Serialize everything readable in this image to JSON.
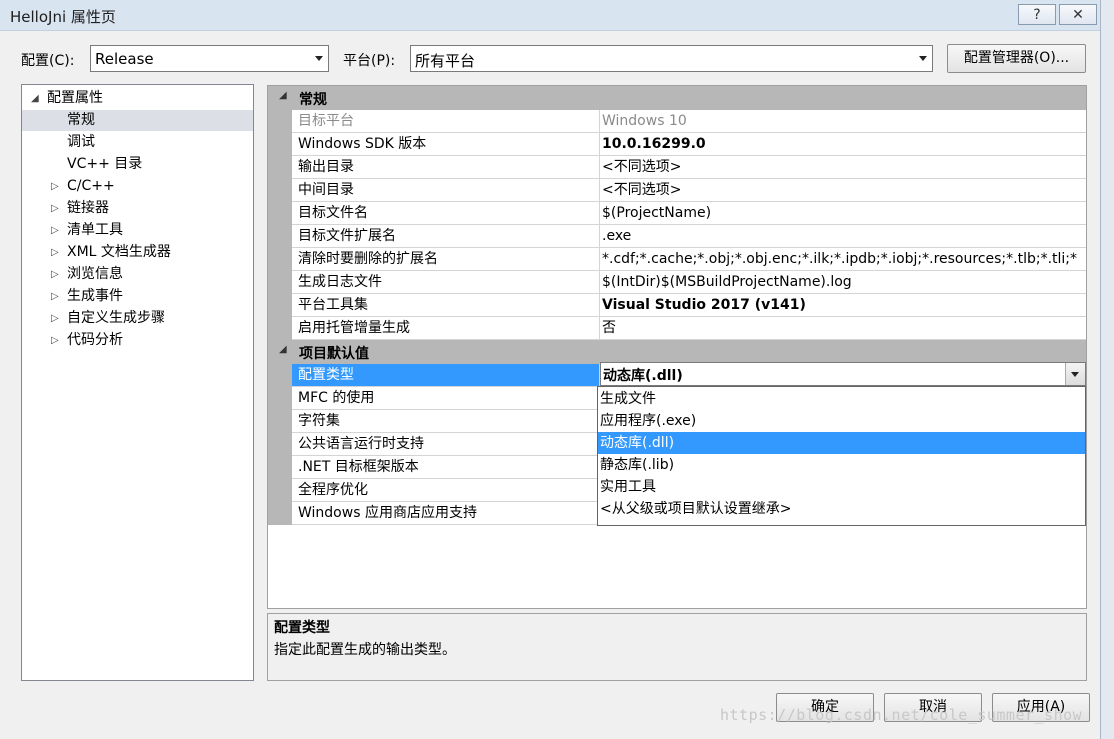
{
  "window": {
    "title": "HelloJni 属性页",
    "help_glyph": "?",
    "close_glyph": "✕"
  },
  "toolbar": {
    "config_label": "配置(C):",
    "config_value": "Release",
    "platform_label": "平台(P):",
    "platform_value": "所有平台",
    "config_manager_label": "配置管理器(O)..."
  },
  "tree": {
    "root_label": "配置属性",
    "items": [
      {
        "label": "常规",
        "selected": true,
        "expandable": false
      },
      {
        "label": "调试",
        "selected": false,
        "expandable": false
      },
      {
        "label": "VC++ 目录",
        "selected": false,
        "expandable": false
      },
      {
        "label": "C/C++",
        "selected": false,
        "expandable": true
      },
      {
        "label": "链接器",
        "selected": false,
        "expandable": true
      },
      {
        "label": "清单工具",
        "selected": false,
        "expandable": true
      },
      {
        "label": "XML 文档生成器",
        "selected": false,
        "expandable": true
      },
      {
        "label": "浏览信息",
        "selected": false,
        "expandable": true
      },
      {
        "label": "生成事件",
        "selected": false,
        "expandable": true
      },
      {
        "label": "自定义生成步骤",
        "selected": false,
        "expandable": true
      },
      {
        "label": "代码分析",
        "selected": false,
        "expandable": true
      }
    ]
  },
  "grid": {
    "sections": [
      {
        "title": "常规",
        "rows": [
          {
            "name": "目标平台",
            "value": "Windows 10",
            "disabled": true
          },
          {
            "name": "Windows SDK 版本",
            "value": "10.0.16299.0",
            "bold": true
          },
          {
            "name": "输出目录",
            "value": "<不同选项>"
          },
          {
            "name": "中间目录",
            "value": "<不同选项>"
          },
          {
            "name": "目标文件名",
            "value": "$(ProjectName)"
          },
          {
            "name": "目标文件扩展名",
            "value": ".exe"
          },
          {
            "name": "清除时要删除的扩展名",
            "value": "*.cdf;*.cache;*.obj;*.obj.enc;*.ilk;*.ipdb;*.iobj;*.resources;*.tlb;*.tli;*"
          },
          {
            "name": "生成日志文件",
            "value": "$(IntDir)$(MSBuildProjectName).log"
          },
          {
            "name": "平台工具集",
            "value": "Visual Studio 2017 (v141)",
            "bold": true
          },
          {
            "name": "启用托管增量生成",
            "value": "否"
          }
        ]
      },
      {
        "title": "项目默认值",
        "rows": [
          {
            "name": "配置类型",
            "value": "动态库(.dll)",
            "bold": true,
            "selected": true
          },
          {
            "name": "MFC 的使用"
          },
          {
            "name": "字符集"
          },
          {
            "name": "公共语言运行时支持"
          },
          {
            "name": ".NET 目标框架版本"
          },
          {
            "name": "全程序优化"
          },
          {
            "name": "Windows 应用商店应用支持"
          }
        ]
      }
    ],
    "dropdown_options": [
      {
        "label": "生成文件",
        "selected": false
      },
      {
        "label": "应用程序(.exe)",
        "selected": false
      },
      {
        "label": "动态库(.dll)",
        "selected": true
      },
      {
        "label": "静态库(.lib)",
        "selected": false
      },
      {
        "label": "实用工具",
        "selected": false
      },
      {
        "label": "<从父级或项目默认设置继承>",
        "selected": false
      }
    ]
  },
  "description": {
    "title": "配置类型",
    "text": "指定此配置生成的输出类型。"
  },
  "buttons": {
    "ok": "确定",
    "cancel": "取消",
    "apply": "应用(A)"
  },
  "watermark": "https://blog.csdn.net/cole_summer_show"
}
